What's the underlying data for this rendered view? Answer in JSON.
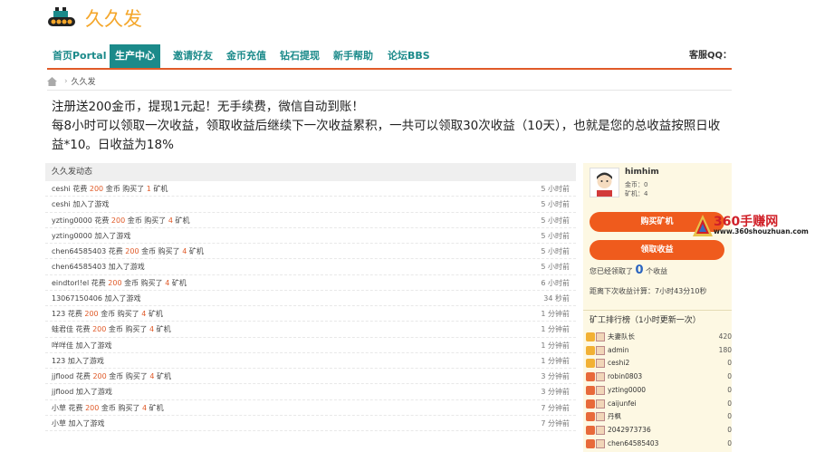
{
  "site": {
    "name": "久久发"
  },
  "nav": {
    "items": [
      "首页Portal",
      "生产中心",
      "邀请好友",
      "金币充值",
      "钻石提现",
      "新手帮助",
      "论坛BBS"
    ],
    "active_index": 1,
    "right_label": "客服QQ："
  },
  "breadcrumb": {
    "current": "久久发"
  },
  "notice": {
    "line1": "注册送200金币，提现1元起！无手续费，微信自动到账！",
    "line2": "每8小时可以领取一次收益，领取收益后继续下一次收益累积，一共可以领取30次收益（10天），也就是您的总收益按照日收益*10。日收益为18%"
  },
  "log": {
    "title": "久久发动态",
    "rows": [
      {
        "user": "ceshi",
        "action": "花费",
        "amount": "200",
        "mid": "金币 购买了",
        "count": "1",
        "unit": "矿机",
        "time": "5 小时前"
      },
      {
        "user": "ceshi",
        "action": "加入了游戏",
        "amount": "",
        "mid": "",
        "count": "",
        "unit": "",
        "time": "5 小时前"
      },
      {
        "user": "yzting0000",
        "action": "花费",
        "amount": "200",
        "mid": "金币 购买了",
        "count": "4",
        "unit": "矿机",
        "time": "5 小时前"
      },
      {
        "user": "yzting0000",
        "action": "加入了游戏",
        "amount": "",
        "mid": "",
        "count": "",
        "unit": "",
        "time": "5 小时前"
      },
      {
        "user": "chen64585403",
        "action": "花费",
        "amount": "200",
        "mid": "金币 购买了",
        "count": "4",
        "unit": "矿机",
        "time": "5 小时前"
      },
      {
        "user": "chen64585403",
        "action": "加入了游戏",
        "amount": "",
        "mid": "",
        "count": "",
        "unit": "",
        "time": "5 小时前"
      },
      {
        "user": "eindtorl!el",
        "action": "花费",
        "amount": "200",
        "mid": "金币 购买了",
        "count": "4",
        "unit": "矿机",
        "time": "6 小时前"
      },
      {
        "user": "13067150406",
        "action": "加入了游戏",
        "amount": "",
        "mid": "",
        "count": "",
        "unit": "",
        "time": "34 秒前"
      },
      {
        "user": "123",
        "action": "花费",
        "amount": "200",
        "mid": "金币 购买了",
        "count": "4",
        "unit": "矿机",
        "time": "1 分钟前"
      },
      {
        "user": "蛙君佳",
        "action": "花费",
        "amount": "200",
        "mid": "金币 购买了",
        "count": "4",
        "unit": "矿机",
        "time": "1 分钟前"
      },
      {
        "user": "咩咩佳",
        "action": "加入了游戏",
        "amount": "",
        "mid": "",
        "count": "",
        "unit": "",
        "time": "1 分钟前"
      },
      {
        "user": "123",
        "action": "加入了游戏",
        "amount": "",
        "mid": "",
        "count": "",
        "unit": "",
        "time": "1 分钟前"
      },
      {
        "user": "jjflood",
        "action": "花费",
        "amount": "200",
        "mid": "金币 购买了",
        "count": "4",
        "unit": "矿机",
        "time": "3 分钟前"
      },
      {
        "user": "jjflood",
        "action": "加入了游戏",
        "amount": "",
        "mid": "",
        "count": "",
        "unit": "",
        "time": "3 分钟前"
      },
      {
        "user": "小草",
        "action": "花费",
        "amount": "200",
        "mid": "金币 购买了",
        "count": "4",
        "unit": "矿机",
        "time": "7 分钟前"
      },
      {
        "user": "小草",
        "action": "加入了游戏",
        "amount": "",
        "mid": "",
        "count": "",
        "unit": "",
        "time": "7 分钟前"
      }
    ]
  },
  "sidebar": {
    "username": "himhim",
    "gold_line": "金币：0",
    "machine_line": "矿机：4",
    "buy_button": "购买矿机",
    "collect_button": "领取收益",
    "earned_prefix": "您已经领取了",
    "earned_count": "0",
    "earned_suffix": "个收益",
    "next_label": "距离下次收益计算：7小时43分10秒",
    "rank_title": "矿工排行榜（1小时更新一次）",
    "rank": [
      {
        "name": "夫妻队长",
        "value": "420"
      },
      {
        "name": "admin",
        "value": "180"
      },
      {
        "name": "ceshi2",
        "value": "0"
      },
      {
        "name": "robin0803",
        "value": "0"
      },
      {
        "name": "yzting0000",
        "value": "0"
      },
      {
        "name": "caijunfei",
        "value": "0"
      },
      {
        "name": "丹枫",
        "value": "0"
      },
      {
        "name": "2042973736",
        "value": "0"
      },
      {
        "name": "chen64585403",
        "value": "0"
      }
    ],
    "rank_badge_colors": [
      "#f2b134",
      "#f2b134",
      "#f2b134",
      "#e86a3a",
      "#e86a3a",
      "#e86a3a",
      "#e86a3a",
      "#e86a3a",
      "#e86a3a"
    ]
  },
  "watermark": {
    "brand": "360手赚网",
    "url": "www.360shouzhuan.com"
  },
  "colors": {
    "accent": "#1b8a8a",
    "orange": "#ef5b1d",
    "logo": "#f4a62a"
  }
}
